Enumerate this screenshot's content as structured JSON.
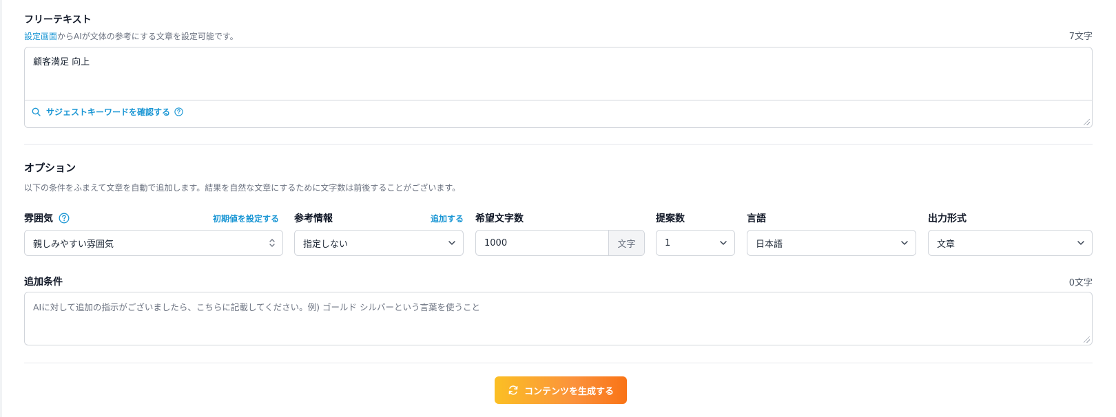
{
  "free_text": {
    "title": "フリーテキスト",
    "note_link": "設定画面",
    "note_rest": "からAIが文体の参考にする文章を設定可能です。",
    "count": "7文字",
    "value": "顧客満足 向上",
    "suggest_label": "サジェストキーワードを確認する"
  },
  "options": {
    "title": "オプション",
    "note": "以下の条件をふまえて文章を自動で追加します。結果を自然な文章にするために文字数は前後することがございます。",
    "mood": {
      "label": "雰囲気",
      "link": "初期値を設定する",
      "value": "親しみやすい雰囲気"
    },
    "reference": {
      "label": "参考情報",
      "link": "追加する",
      "value": "指定しない"
    },
    "length": {
      "label": "希望文字数",
      "value": "1000",
      "unit": "文字"
    },
    "proposals": {
      "label": "提案数",
      "value": "1"
    },
    "language": {
      "label": "言語",
      "value": "日本語"
    },
    "output_format": {
      "label": "出力形式",
      "value": "文章"
    }
  },
  "additional": {
    "title": "追加条件",
    "count": "0文字",
    "placeholder": "AIに対して追加の指示がございましたら、こちらに記載してください。例) ゴールド シルバーという言葉を使うこと"
  },
  "generate_button": {
    "label": "コンテンツを生成する"
  },
  "colors": {
    "accent": "#1a96d4",
    "button_start": "#fbbf24",
    "button_end": "#f97316"
  }
}
